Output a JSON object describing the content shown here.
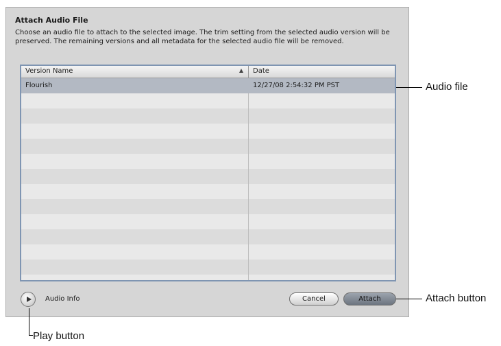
{
  "dialog": {
    "title": "Attach Audio File",
    "description": "Choose an audio file to attach to the selected image. The trim setting from the selected audio version will be preserved. The remaining versions and all metadata for the selected audio file will be removed."
  },
  "table": {
    "columns": [
      "Version Name",
      "Date"
    ],
    "sorted_column": "Version Name",
    "sort_direction": "ascending",
    "rows": [
      {
        "name": "Flourish",
        "date": "12/27/08 2:54:32 PM PST",
        "selected": true
      }
    ]
  },
  "footer": {
    "audio_info_label": "Audio Info",
    "cancel_label": "Cancel",
    "attach_label": "Attach"
  },
  "callouts": {
    "audio_file": "Audio file",
    "attach_button": "Attach button",
    "play_button": "Play button"
  },
  "colors": {
    "dialog_bg": "#d6d6d6",
    "selection": "#b3b9c3",
    "table_border": "#7f95b2",
    "default_button": "#7d858f"
  }
}
